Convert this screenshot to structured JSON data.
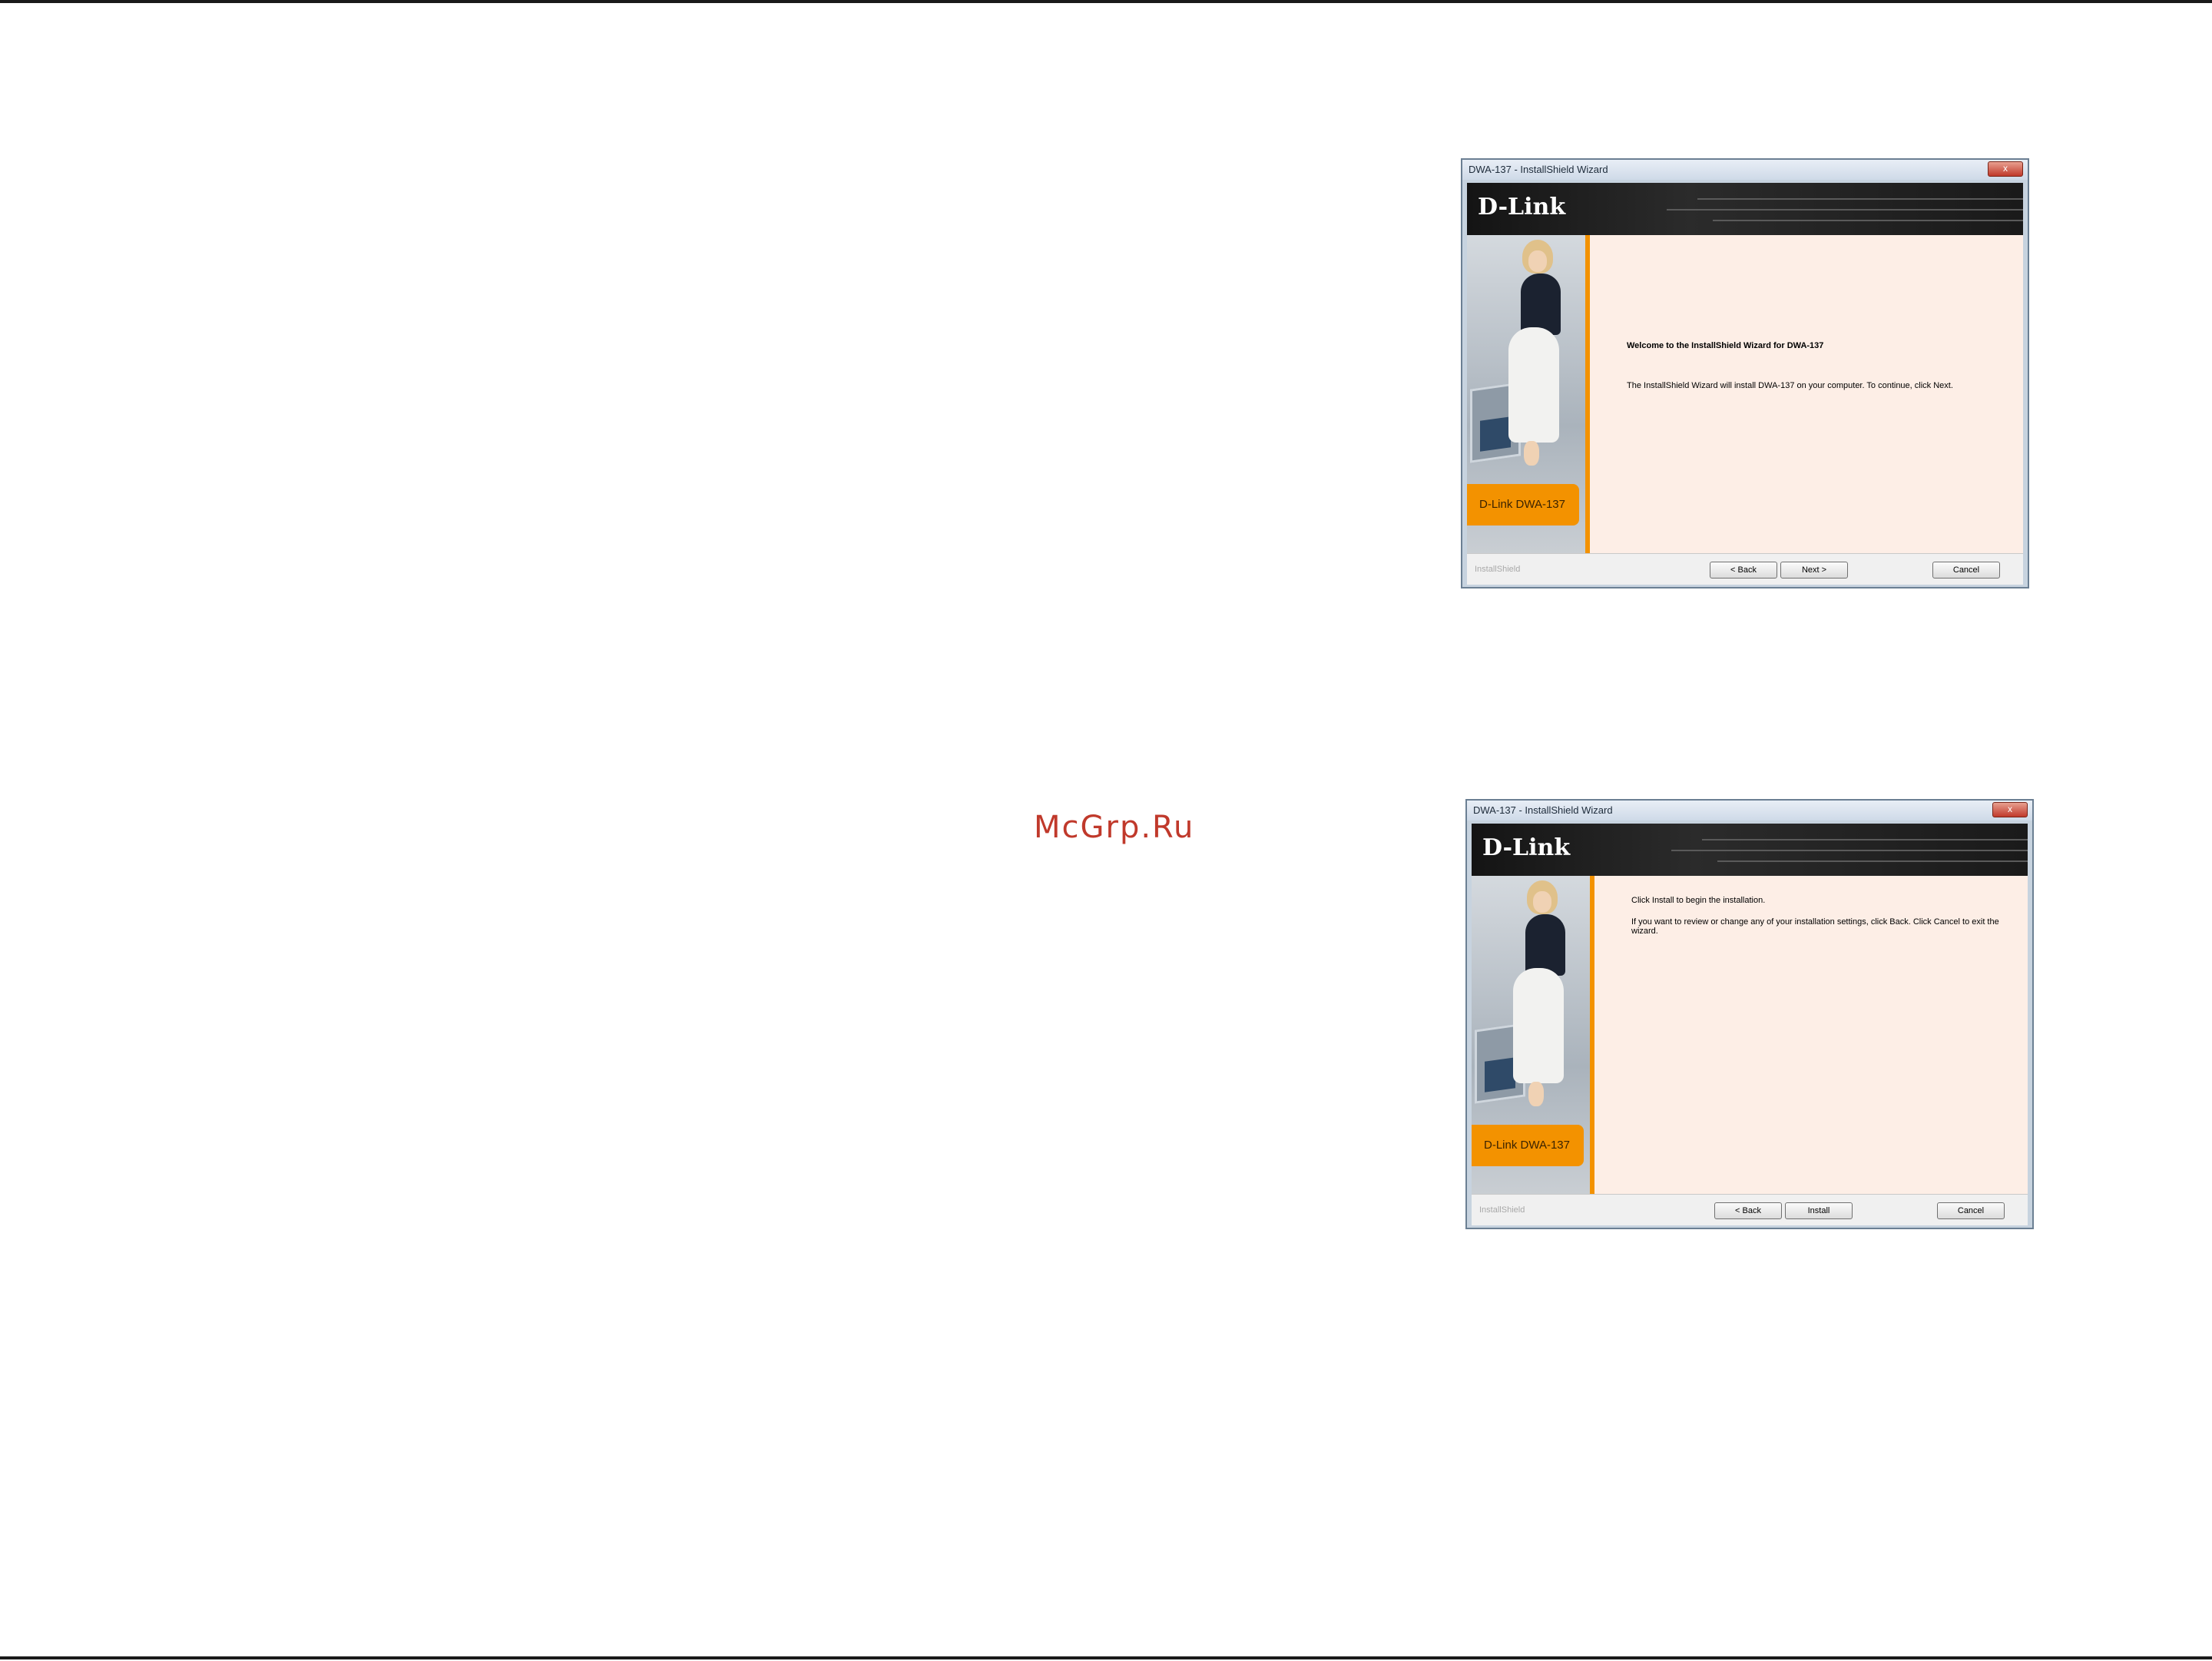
{
  "watermark": "McGrp.Ru",
  "wizards": [
    {
      "title": "DWA-137 - InstallShield Wizard",
      "close_symbol": "x",
      "brand_logo": "D-Link",
      "side_badge": "D-Link  DWA-137",
      "content": {
        "heading": "Welcome to the InstallShield Wizard for DWA-137",
        "body": "The InstallShield Wizard will install DWA-137 on your computer.  To continue, click Next."
      },
      "footer_brand": "InstallShield",
      "buttons": {
        "back": "< Back",
        "next": "Next >",
        "cancel": "Cancel"
      }
    },
    {
      "title": "DWA-137 - InstallShield Wizard",
      "close_symbol": "x",
      "brand_logo": "D-Link",
      "side_badge": "D-Link  DWA-137",
      "content": {
        "line1": "Click Install to begin the installation.",
        "line2": "If you want to review or change any of your installation settings, click Back. Click Cancel to exit the wizard."
      },
      "footer_brand": "InstallShield",
      "buttons": {
        "back": "< Back",
        "install": "Install",
        "cancel": "Cancel"
      }
    }
  ]
}
